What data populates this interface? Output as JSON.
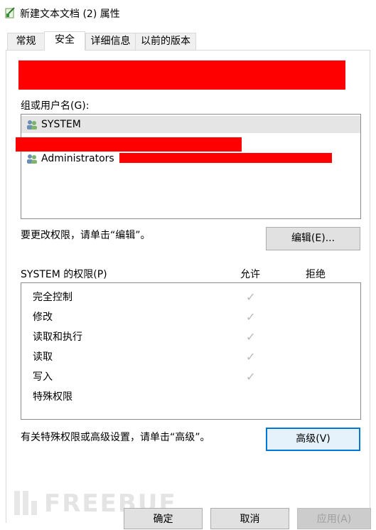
{
  "window": {
    "title": "新建文本文档 (2) 属性"
  },
  "tabs": [
    {
      "label": "常规"
    },
    {
      "label": "安全"
    },
    {
      "label": "详细信息"
    },
    {
      "label": "以前的版本"
    }
  ],
  "security": {
    "groups_label": "组或用户名(G):",
    "users": [
      {
        "name": "SYSTEM"
      },
      {
        "name": ""
      },
      {
        "name": "Administrators"
      }
    ],
    "edit_hint": "要更改权限，请单击“编辑”。",
    "edit_button": "编辑(E)...",
    "perm_header": "SYSTEM 的权限(P)",
    "allow_header": "允许",
    "deny_header": "拒绝",
    "permissions": [
      {
        "name": "完全控制",
        "allow": true,
        "deny": false
      },
      {
        "name": "修改",
        "allow": true,
        "deny": false
      },
      {
        "name": "读取和执行",
        "allow": true,
        "deny": false
      },
      {
        "name": "读取",
        "allow": true,
        "deny": false
      },
      {
        "name": "写入",
        "allow": true,
        "deny": false
      },
      {
        "name": "特殊权限",
        "allow": false,
        "deny": false
      }
    ],
    "advanced_hint": "有关特殊权限或高级设置，请单击“高级”。",
    "advanced_button": "高级(V)"
  },
  "footer": {
    "ok_button": "确定",
    "cancel_button": "取消",
    "apply_button": "应用(A)"
  },
  "watermark": {
    "text": "FREEBUF"
  },
  "icons": {
    "check": "checkmark-icon",
    "user": "user-group-icon",
    "app": "notepad-icon"
  },
  "colors": {
    "redaction": "#ff0000",
    "focus": "#0078d7",
    "check_disabled": "#b8b8b8"
  }
}
